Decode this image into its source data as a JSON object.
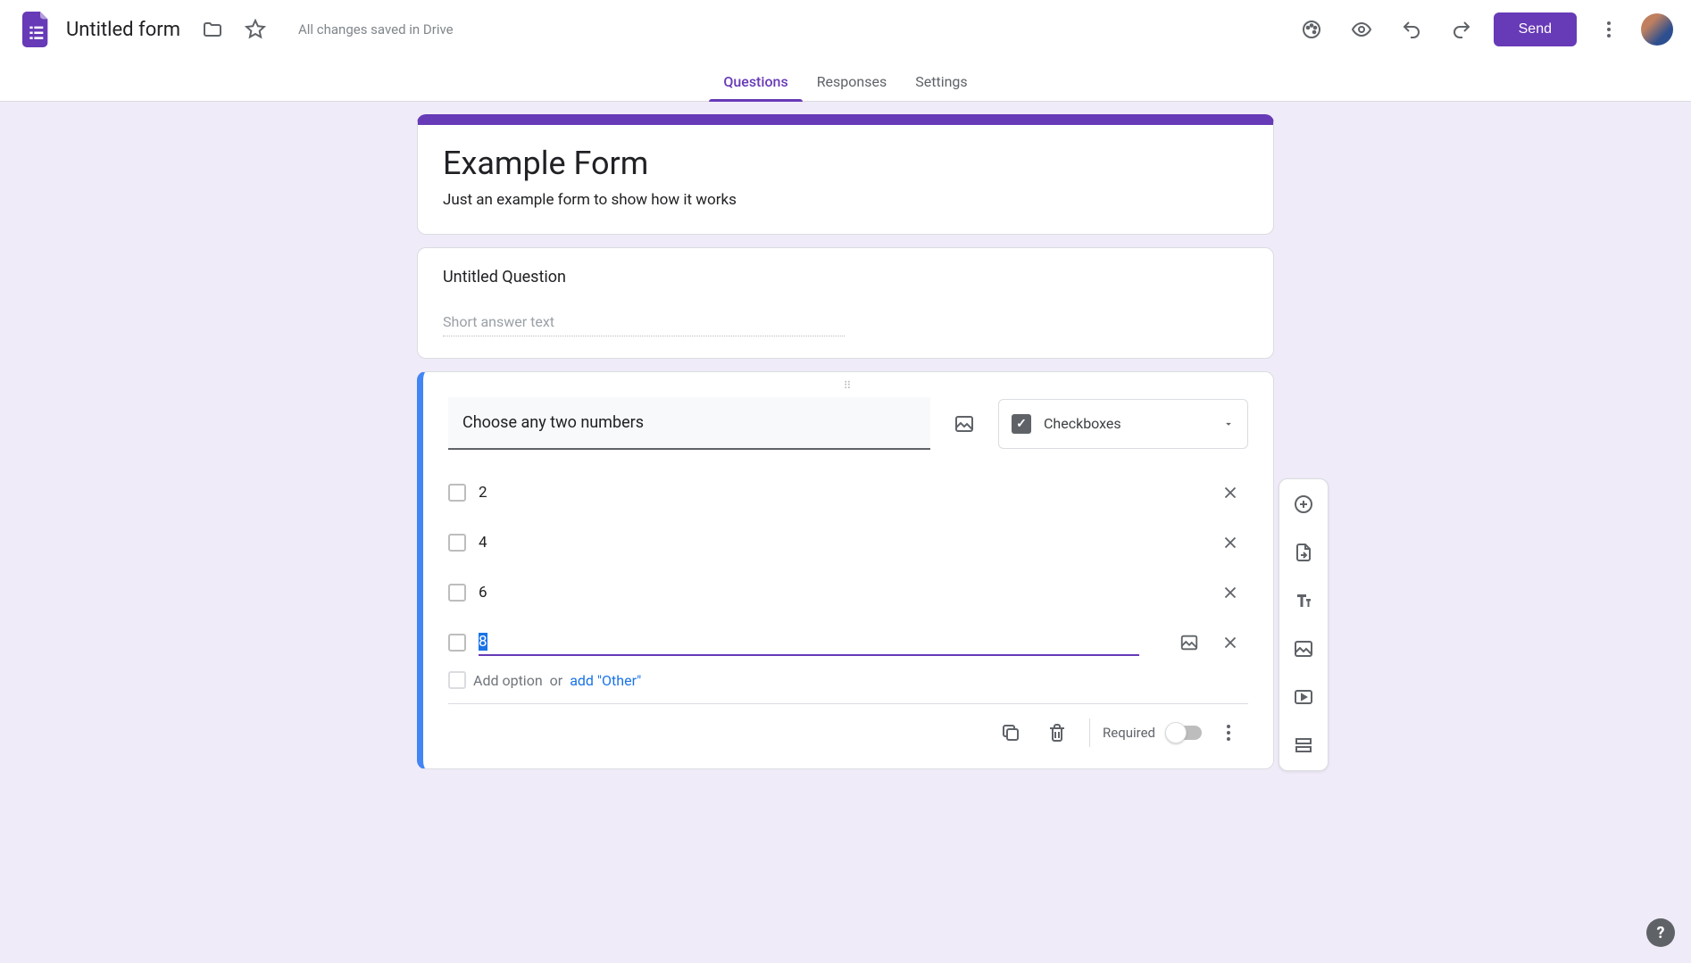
{
  "header": {
    "doc_title": "Untitled form",
    "save_status": "All changes saved in Drive",
    "send_label": "Send"
  },
  "tabs": [
    {
      "label": "Questions",
      "active": true
    },
    {
      "label": "Responses",
      "active": false
    },
    {
      "label": "Settings",
      "active": false
    }
  ],
  "form_header": {
    "title": "Example Form",
    "description": "Just an example form to show how it works"
  },
  "question1": {
    "title": "Untitled Question",
    "short_answer_placeholder": "Short answer text"
  },
  "question2": {
    "title": "Choose any two numbers",
    "type_label": "Checkboxes",
    "options": [
      "2",
      "4",
      "6",
      "8"
    ],
    "editing_option_index": 3,
    "add_option_text": "Add option",
    "add_option_or": "or",
    "add_other_text": "add \"Other\"",
    "required_label": "Required",
    "required": false
  },
  "side_tools": [
    "add-question",
    "import-questions",
    "add-title",
    "add-image",
    "add-video",
    "add-section"
  ],
  "colors": {
    "accent": "#673ab7",
    "active_blue": "#4285f4"
  }
}
